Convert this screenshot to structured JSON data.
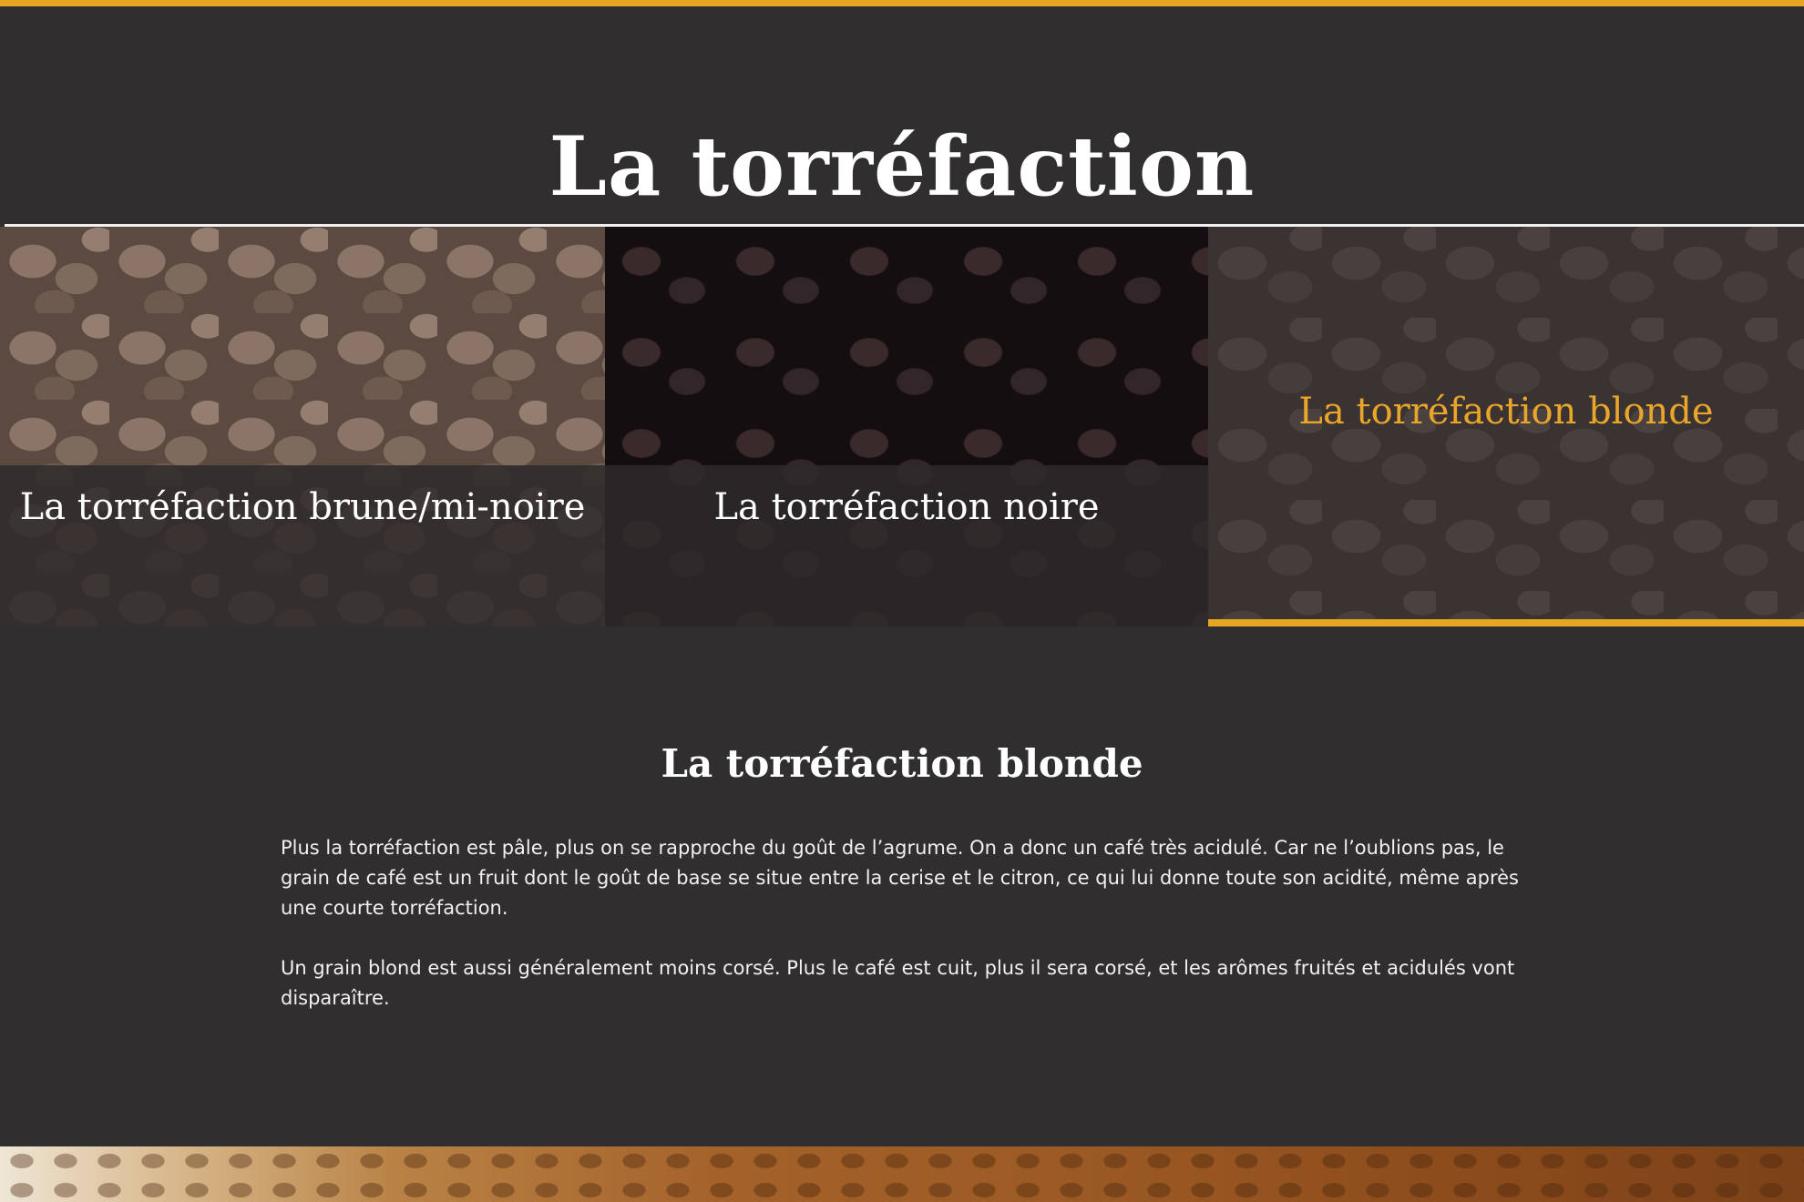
{
  "page": {
    "title": "La torréfaction"
  },
  "colors": {
    "accent": "#e5a622",
    "background": "#302e2f",
    "active_label": "#e9a62b",
    "text": "#ffffff"
  },
  "tiles": [
    {
      "label": "La torréfaction brune/mi-noire",
      "active": false
    },
    {
      "label": "La torréfaction noire",
      "active": false
    },
    {
      "label": "La torréfaction blonde",
      "active": true
    }
  ],
  "content": {
    "heading": "La torréfaction blonde",
    "paragraphs": [
      "Plus la torréfaction est pâle, plus on se rapproche du goût de l’agrume. On a donc un café très acidulé. Car ne l’oublions pas, le grain de café est un fruit dont le goût de base se situe entre la cerise et le citron, ce qui lui donne toute son acidité, même après une courte torréfaction.",
      "Un grain blond est aussi généralement moins corsé. Plus le café est cuit, plus il sera corsé, et les arômes fruités et acidulés vont disparaître."
    ]
  }
}
